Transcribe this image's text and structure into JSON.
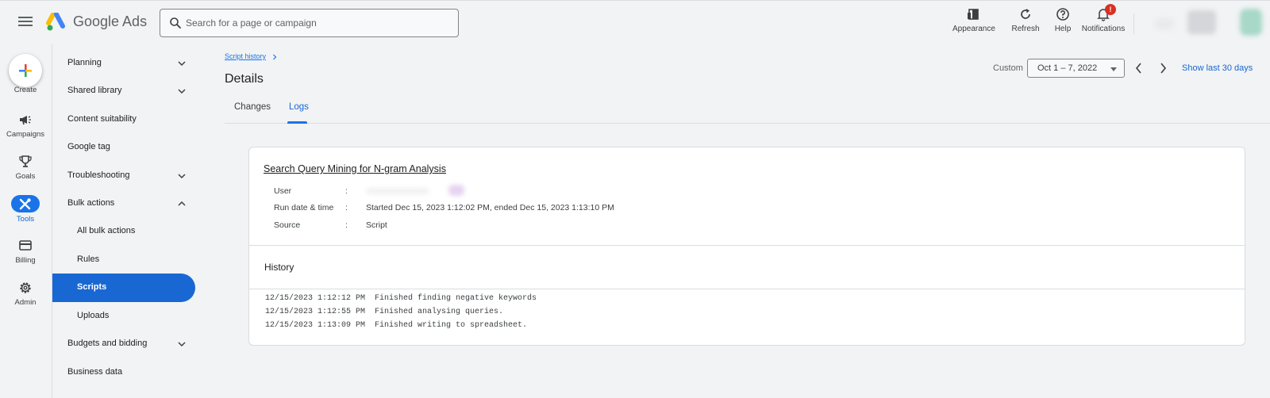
{
  "header": {
    "product_name": "Google Ads",
    "search_placeholder": "Search for a page or campaign",
    "actions": [
      {
        "label": "Appearance",
        "icon": "appearance-icon"
      },
      {
        "label": "Refresh",
        "icon": "refresh-icon"
      },
      {
        "label": "Help",
        "icon": "help-icon"
      },
      {
        "label": "Notifications",
        "icon": "bell-icon",
        "badge": "!"
      }
    ]
  },
  "rail": {
    "create_label": "Create",
    "items": [
      {
        "label": "Campaigns",
        "icon": "megaphone-icon"
      },
      {
        "label": "Goals",
        "icon": "trophy-icon"
      },
      {
        "label": "Tools",
        "icon": "tools-icon",
        "active": true
      },
      {
        "label": "Billing",
        "icon": "credit-card-icon"
      },
      {
        "label": "Admin",
        "icon": "gear-icon"
      }
    ]
  },
  "sidebar": {
    "items": [
      {
        "label": "Planning",
        "chevron": "down"
      },
      {
        "label": "Shared library",
        "chevron": "down"
      },
      {
        "label": "Content suitability"
      },
      {
        "label": "Google tag"
      },
      {
        "label": "Troubleshooting",
        "chevron": "down"
      },
      {
        "label": "Bulk actions",
        "chevron": "up"
      },
      {
        "label": "All bulk actions",
        "sub": true
      },
      {
        "label": "Rules",
        "sub": true
      },
      {
        "label": "Scripts",
        "sub": true,
        "selected": true
      },
      {
        "label": "Uploads",
        "sub": true
      },
      {
        "label": "Budgets and bidding",
        "chevron": "down"
      },
      {
        "label": "Business data"
      }
    ]
  },
  "main": {
    "breadcrumb": "Script history",
    "title": "Details",
    "date_range": {
      "label": "Custom",
      "value": "Oct 1 – 7, 2022",
      "show_last": "Show last 30 days"
    },
    "tabs": [
      {
        "label": "Changes"
      },
      {
        "label": "Logs",
        "active": true
      }
    ]
  },
  "card": {
    "script_name": "Search Query Mining for N-gram Analysis",
    "meta": [
      {
        "key": "User",
        "sep": ":",
        "value": ""
      },
      {
        "key": "Run date & time",
        "sep": ":",
        "value": "Started Dec 15, 2023 1:12:02 PM, ended Dec 15, 2023 1:13:10 PM"
      },
      {
        "key": "Source",
        "sep": ":",
        "value": "Script"
      }
    ],
    "history_title": "History",
    "logs": [
      "12/15/2023 1:12:12 PM  Finished finding negative keywords",
      "12/15/2023 1:12:55 PM  Finished analysing queries.",
      "12/15/2023 1:13:09 PM  Finished writing to spreadsheet."
    ]
  },
  "colors": {
    "accent": "#1a73e8",
    "selected_nav": "#1967d2",
    "badge": "#d93025",
    "background": "#f1f3f4"
  }
}
